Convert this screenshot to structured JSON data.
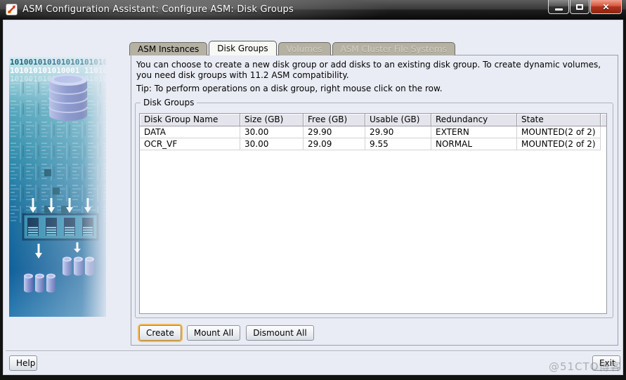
{
  "window": {
    "title": "ASM Configuration Assistant: Configure ASM: Disk Groups",
    "controls": {
      "minimize": "minimize",
      "maximize": "maximize",
      "close": "✕"
    }
  },
  "tabs": [
    {
      "label": "ASM Instances",
      "state": "enabled"
    },
    {
      "label": "Disk Groups",
      "state": "active"
    },
    {
      "label": "Volumes",
      "state": "disabled"
    },
    {
      "label": "ASM Cluster File Systems",
      "state": "disabled"
    }
  ],
  "description": {
    "text": "You can choose to create a new disk group or add disks to an existing disk group. To create dynamic volumes, you need disk groups with 11.2 ASM compatibility.",
    "tip": "Tip: To perform operations on a disk group, right mouse click on the row."
  },
  "group_box": {
    "title": "Disk Groups"
  },
  "table": {
    "columns": [
      "Disk Group Name",
      "Size (GB)",
      "Free (GB)",
      "Usable (GB)",
      "Redundancy",
      "State"
    ],
    "rows": [
      [
        "DATA",
        "30.00",
        "29.90",
        "29.90",
        "EXTERN",
        "MOUNTED(2 of 2)"
      ],
      [
        "OCR_VF",
        "30.00",
        "29.09",
        "9.55",
        "NORMAL",
        "MOUNTED(2 of 2)"
      ]
    ]
  },
  "buttons": {
    "create": "Create",
    "mount_all": "Mount All",
    "dismount_all": "Dismount All",
    "help": "Help",
    "exit": "Exit"
  },
  "sidebar": {
    "binary_rows": [
      "101001010101010101010",
      "101010101010001 11010",
      "101001010101010101010"
    ]
  },
  "watermark": "@51CTO博客",
  "colors": {
    "focus_ring": "#f0ba5c",
    "close_button_red": "#b03420",
    "sidebar_teal": "#2f8cab",
    "sidebar_deep_blue": "#11609a",
    "content_bg": "#e9ecf4",
    "tab_inactive_bg": "#b5b1a3",
    "table_header_bg": "#e4e4ec"
  }
}
